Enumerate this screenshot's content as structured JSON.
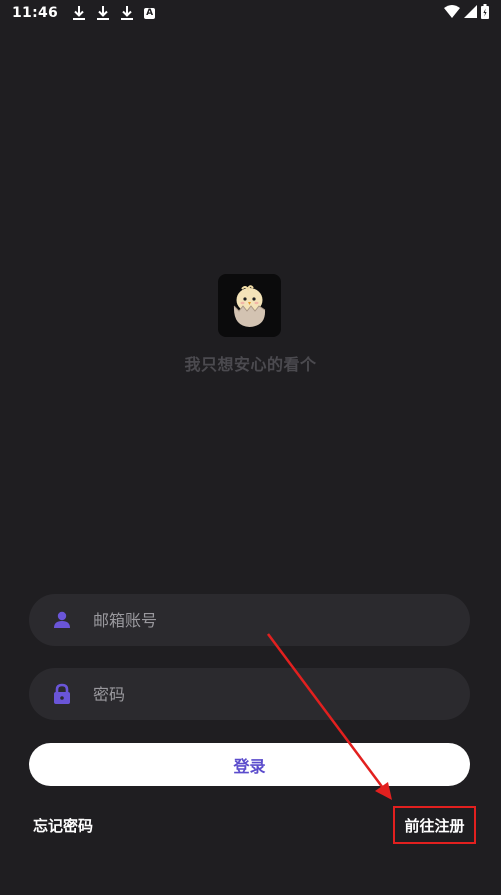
{
  "status_bar": {
    "time": "11:46",
    "badge_letter": "A",
    "icons": [
      "download-icon",
      "download-icon",
      "download-icon",
      "a-badge-icon",
      "wifi-icon",
      "signal-icon",
      "battery-icon"
    ]
  },
  "branding": {
    "slogan": "我只想安心的看个"
  },
  "login_form": {
    "email_placeholder": "邮箱账号",
    "password_placeholder": "密码",
    "login_label": "登录",
    "forgot_password_label": "忘记密码",
    "register_label": "前往注册"
  },
  "colors": {
    "background": "#1f1e21",
    "field_background": "#2b2a2e",
    "accent": "#6a55d8",
    "annotation": "#e2201f"
  }
}
